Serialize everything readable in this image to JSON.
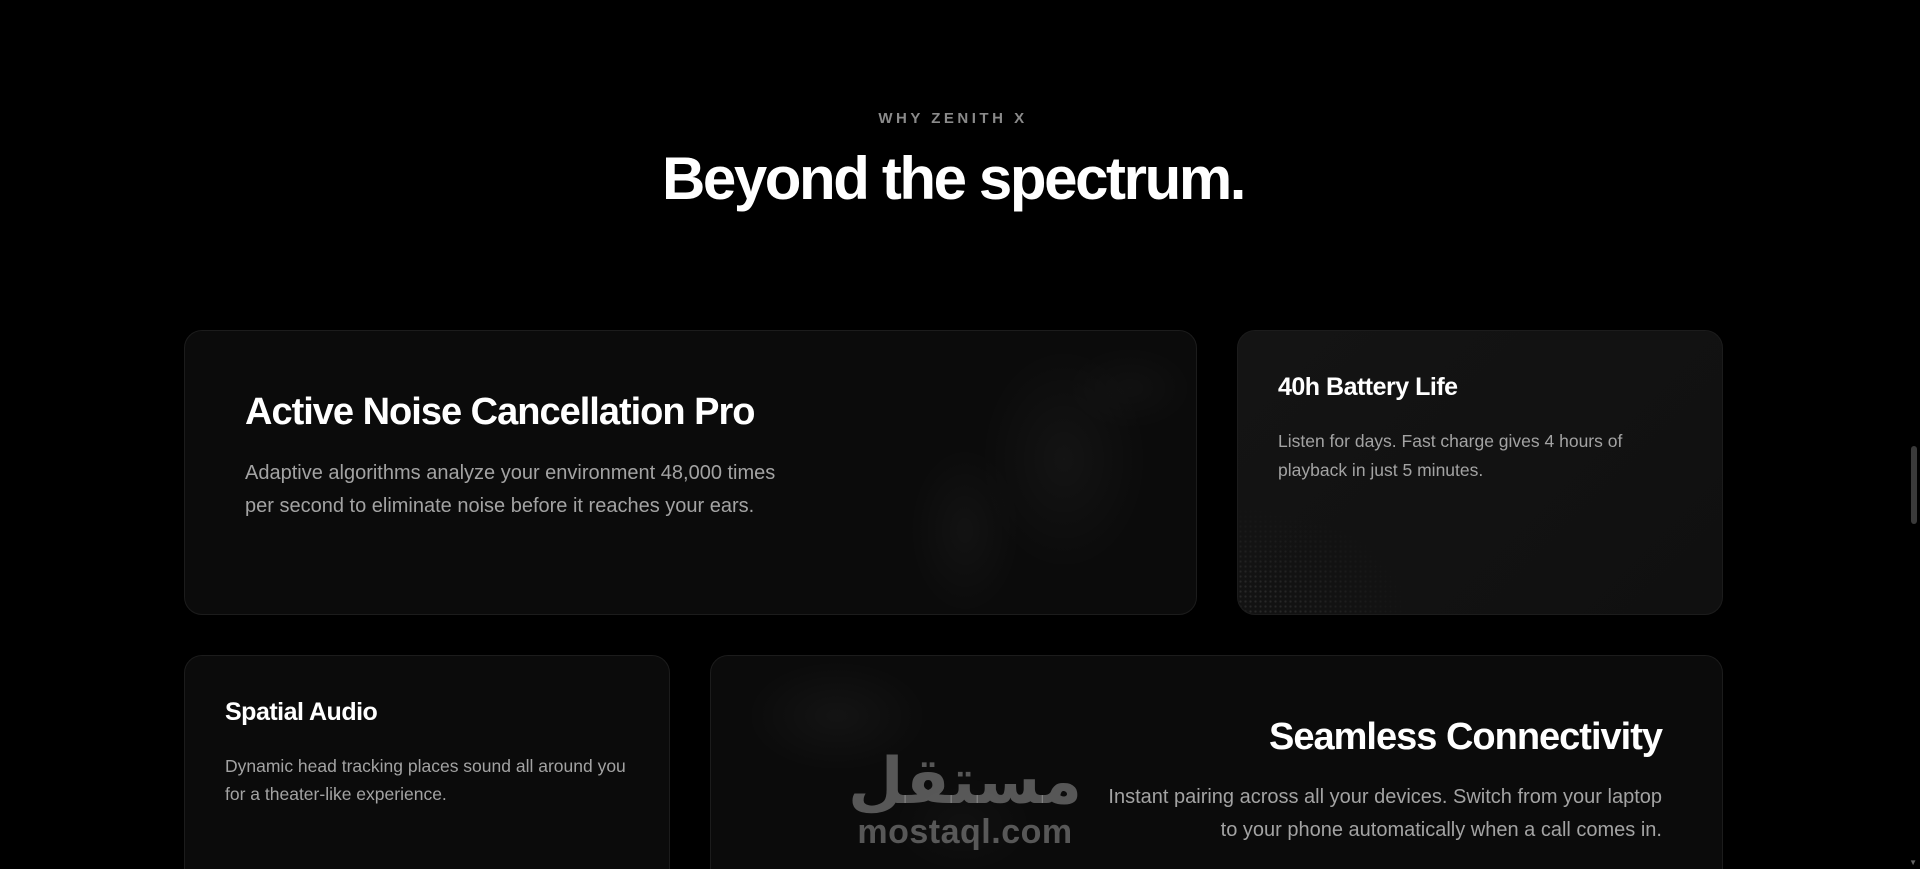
{
  "section": {
    "eyebrow": "WHY ZENITH X",
    "headline": "Beyond the spectrum."
  },
  "features": {
    "anc": {
      "title": "Active Noise Cancellation Pro",
      "description": "Adaptive algorithms analyze your environment 48,000 times per second to eliminate noise before it reaches your ears."
    },
    "battery": {
      "title": "40h Battery Life",
      "description": "Listen for days. Fast charge gives 4 hours of playback in just 5 minutes."
    },
    "spatial": {
      "title": "Spatial Audio",
      "description": "Dynamic head tracking places sound all around you for a theater-like experience."
    },
    "connectivity": {
      "title": "Seamless Connectivity",
      "description": "Instant pairing across all your devices. Switch from your laptop to your phone automatically when a call comes in."
    }
  },
  "watermark": {
    "arabic": "مستقل",
    "latin": "mostaql.com"
  },
  "scrollbar": {
    "down_arrow": "▼"
  },
  "colors": {
    "background": "#000000",
    "card": "#0b0b0b",
    "card_border": "#1c1c1c",
    "heading": "#ffffff",
    "body_text": "#a3a3a3",
    "eyebrow": "#8a8a8a"
  }
}
